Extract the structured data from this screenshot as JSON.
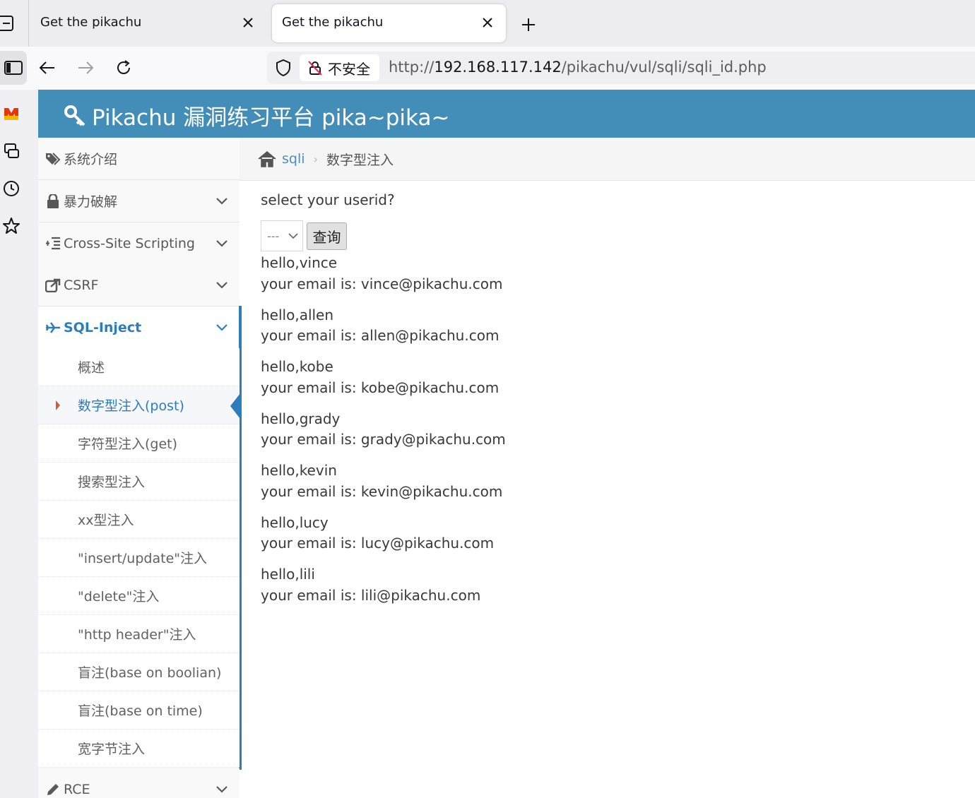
{
  "browser": {
    "tabs": [
      {
        "title": "Get the pikachu",
        "active": false
      },
      {
        "title": "Get the pikachu",
        "active": true
      }
    ],
    "security_label": "不安全",
    "url_scheme": "http://",
    "url_host": "192.168.117.142",
    "url_path": "/pikachu/vul/sqli/sqli_id.php"
  },
  "header": {
    "title": "Pikachu 漏洞练习平台 pika~pika~"
  },
  "menu": {
    "items": [
      {
        "label": "系统介绍",
        "icon": "tag-icon"
      },
      {
        "label": "暴力破解",
        "icon": "lock-icon"
      },
      {
        "label": "Cross-Site Scripting",
        "icon": "indent-icon"
      },
      {
        "label": "CSRF",
        "icon": "share-icon"
      },
      {
        "label": "SQL-Inject",
        "icon": "plane-icon"
      },
      {
        "label": "RCE",
        "icon": "pencil-icon"
      }
    ],
    "sql_sub": [
      "概述",
      "数字型注入(post)",
      "字符型注入(get)",
      "搜索型注入",
      "xx型注入",
      "\"insert/update\"注入",
      "\"delete\"注入",
      "\"http header\"注入",
      "盲注(base on boolian)",
      "盲注(base on time)",
      "宽字节注入"
    ],
    "selected_sub_index": 1
  },
  "breadcrumb": {
    "link": "sqli",
    "current": "数字型注入"
  },
  "main": {
    "prompt": "select your userid?",
    "select_value": "---",
    "query_button": "查询",
    "results": [
      {
        "hello": "hello,vince",
        "email": "your email is: vince@pikachu.com"
      },
      {
        "hello": "hello,allen",
        "email": "your email is: allen@pikachu.com"
      },
      {
        "hello": "hello,kobe",
        "email": "your email is: kobe@pikachu.com"
      },
      {
        "hello": "hello,grady",
        "email": "your email is: grady@pikachu.com"
      },
      {
        "hello": "hello,kevin",
        "email": "your email is: kevin@pikachu.com"
      },
      {
        "hello": "hello,lucy",
        "email": "your email is: lucy@pikachu.com"
      },
      {
        "hello": "hello,lili",
        "email": "your email is: lili@pikachu.com"
      }
    ]
  },
  "colors": {
    "header_bg": "#438eb9",
    "accent": "#2b7dbc",
    "link": "#4c8fbd"
  }
}
